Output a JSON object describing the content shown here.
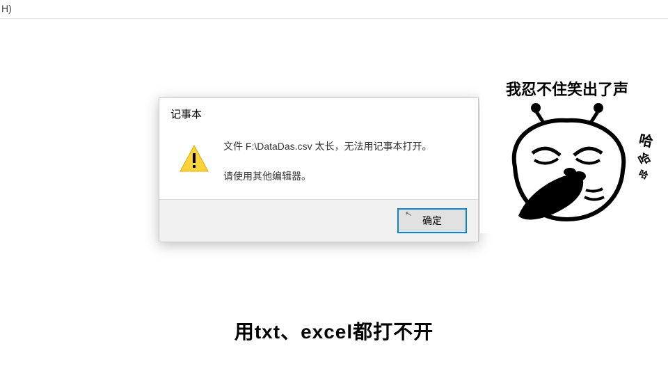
{
  "top_fragment": "H)",
  "dialog": {
    "title": "记事本",
    "message_line1": "文件 F:\\DataDas.csv 太长，无法用记事本打开。",
    "message_line2": "请使用其他编辑器。",
    "ok_label": "确定"
  },
  "meme": {
    "top_text": "我忍不住笑出了声",
    "laugh1": "哈",
    "laugh2": "哈",
    "laugh3": "哈"
  },
  "caption": "用txt、excel都打不开"
}
